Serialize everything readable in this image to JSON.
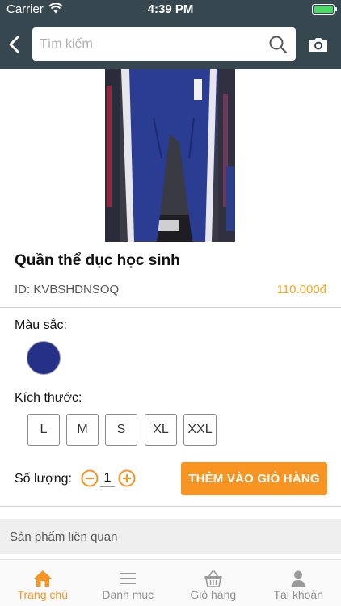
{
  "status_bar": {
    "carrier": "Carrier",
    "time": "4:39 PM"
  },
  "search": {
    "placeholder": "Tìm kiếm",
    "value": ""
  },
  "product": {
    "title": "Quần thể dục học sinh",
    "id_text": "ID: KVBSHDNSOQ",
    "price": "110.000đ",
    "image_icon": "blue-track-pants-photo"
  },
  "color_section": {
    "label": "Màu sắc:",
    "options": [
      {
        "name": "navy",
        "hex": "#243187"
      }
    ]
  },
  "size_section": {
    "label": "Kích thước:",
    "options": [
      "L",
      "M",
      "S",
      "XL",
      "XXL"
    ]
  },
  "quantity": {
    "label": "Số lượng:",
    "value": "1"
  },
  "add_to_cart_label": "THÊM VÀO GIỎ HÀNG",
  "related_label": "Sản phẩm liên quan",
  "tab_bar": {
    "tabs": [
      {
        "label": "Trang chủ",
        "icon": "home-icon",
        "active": true
      },
      {
        "label": "Danh mục",
        "icon": "list-icon",
        "active": false
      },
      {
        "label": "Giỏ hàng",
        "icon": "basket-icon",
        "active": false
      },
      {
        "label": "Tài khoản",
        "icon": "user-icon",
        "active": false
      }
    ]
  },
  "colors": {
    "header": "#37474f",
    "accent": "#f79422",
    "price": "#f5a623"
  }
}
